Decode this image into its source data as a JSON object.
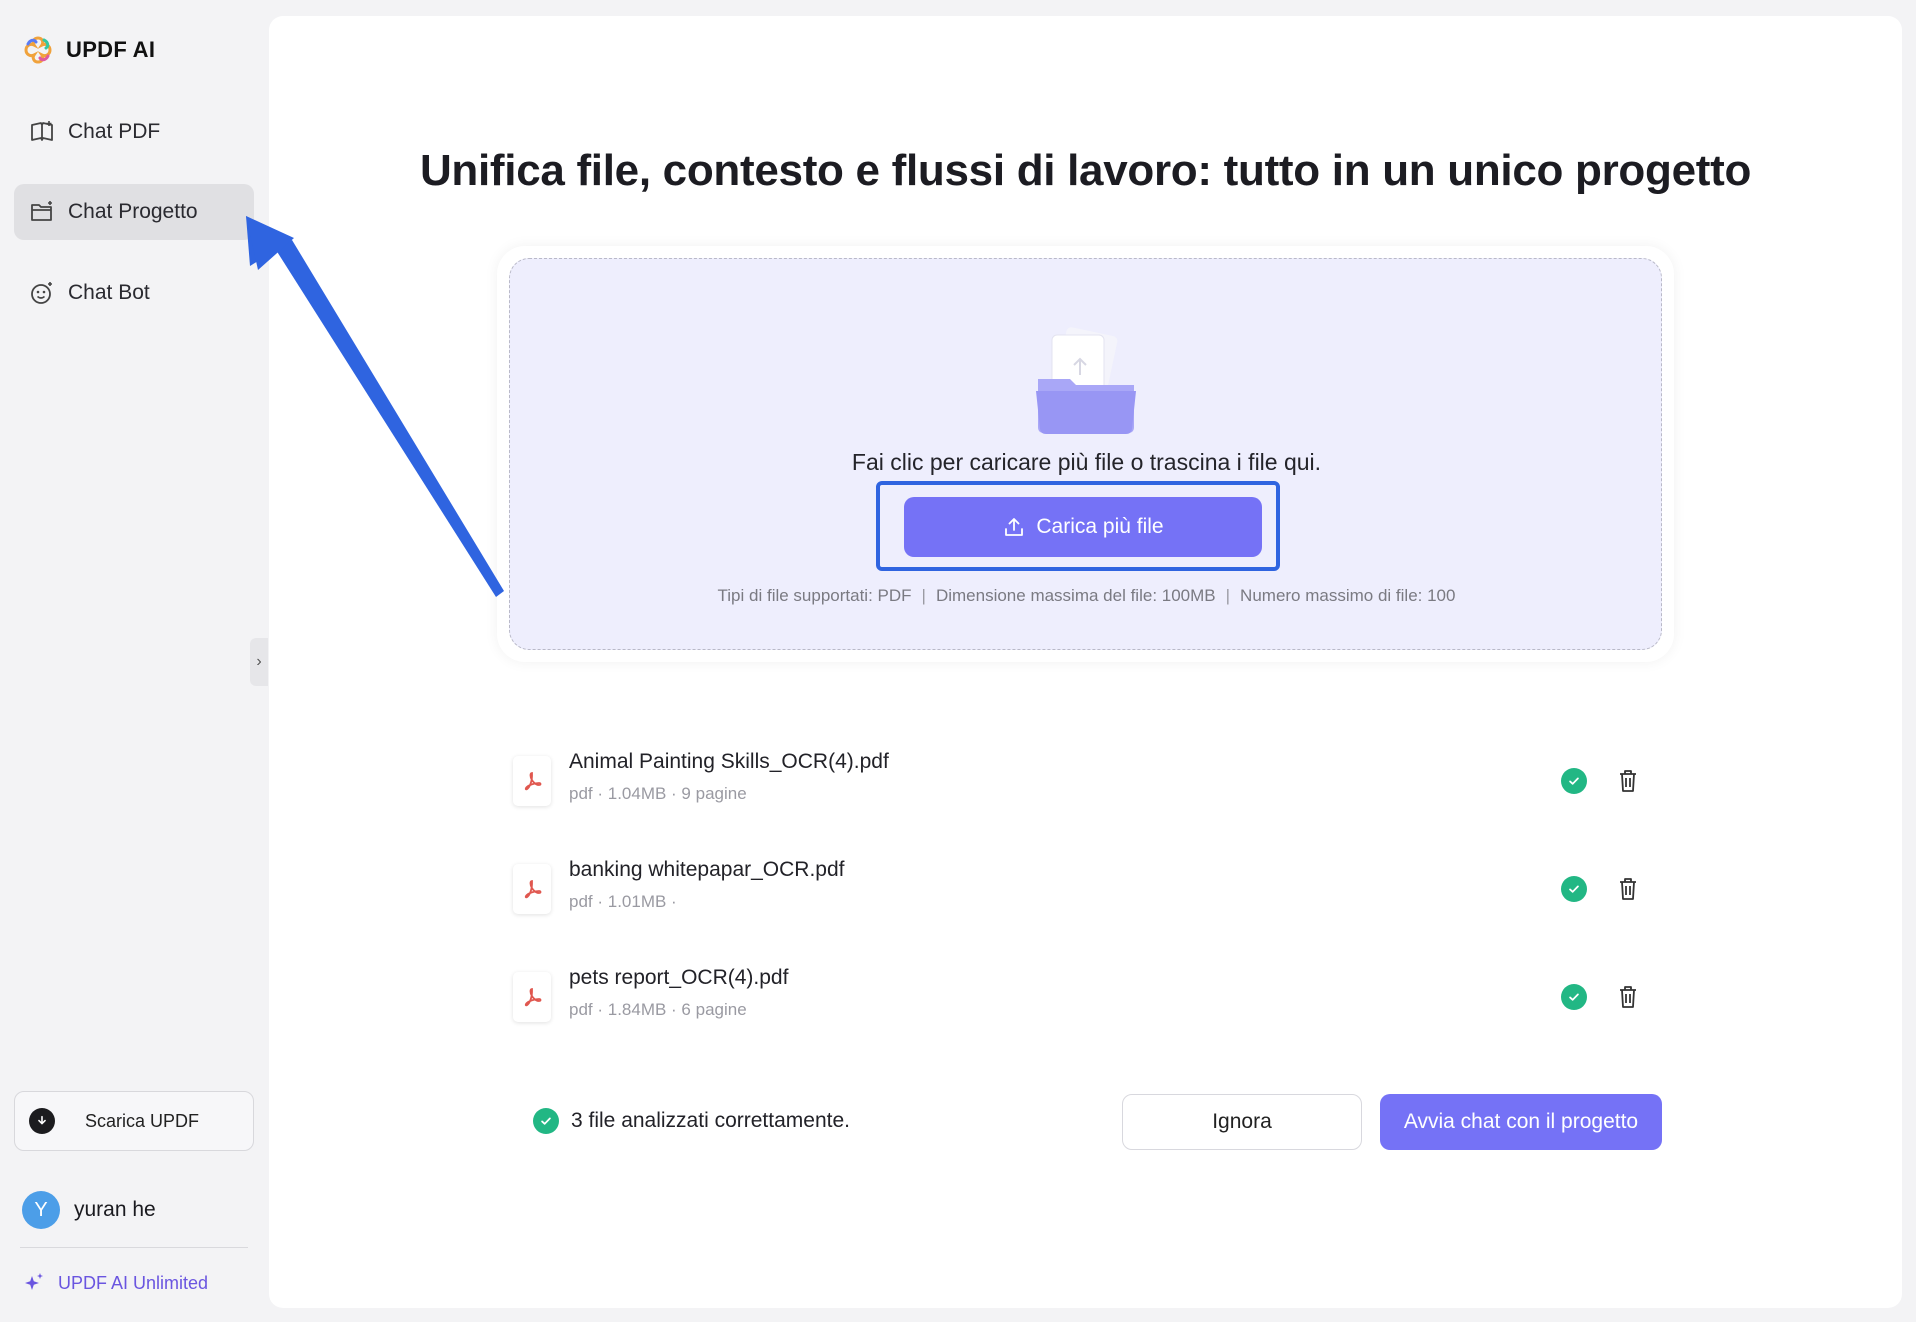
{
  "app": {
    "name": "UPDF AI"
  },
  "sidebar": {
    "items": [
      {
        "label": "Chat PDF",
        "icon": "book-icon",
        "active": false
      },
      {
        "label": "Chat Progetto",
        "icon": "folder-icon",
        "active": true
      },
      {
        "label": "Chat Bot",
        "icon": "bot-face-icon",
        "active": false
      }
    ],
    "collapse_icon": "chevron-right-icon",
    "download_label": "Scarica UPDF",
    "user": {
      "initial": "Y",
      "name": "yuran he"
    },
    "plan_label": "UPDF AI Unlimited"
  },
  "main": {
    "title": "Unifica file, contesto e flussi di lavoro: tutto in un unico progetto",
    "upload": {
      "hint": "Fai clic per caricare più file o trascina i file qui.",
      "button_label": "Carica più file",
      "supported_types": "Tipi di file supportati: PDF",
      "max_size": "Dimensione massima del file: 100MB",
      "max_files": "Numero massimo di file: 100"
    },
    "files": [
      {
        "name": "Animal Painting Skills_OCR(4).pdf",
        "meta": "pdf · 1.04MB · 9 pagine",
        "status": "ok"
      },
      {
        "name": "banking whitepapar_OCR.pdf",
        "meta": "pdf · 1.01MB ·",
        "status": "ok"
      },
      {
        "name": "pets report_OCR(4).pdf",
        "meta": "pdf · 1.84MB · 6 pagine",
        "status": "ok"
      }
    ],
    "status_message": "3 file analizzati correttamente.",
    "ignore_label": "Ignora",
    "start_label": "Avvia chat con il progetto"
  },
  "colors": {
    "accent": "#7572f6",
    "success": "#22b784",
    "annotation": "#2f64e0",
    "plan": "#6a55e0"
  }
}
